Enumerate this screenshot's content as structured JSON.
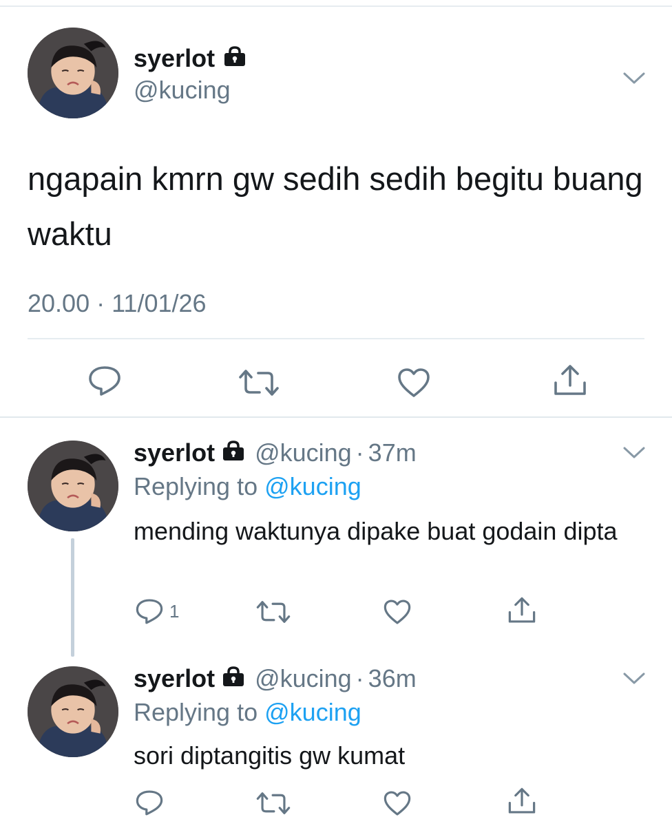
{
  "main_tweet": {
    "display_name": "syerlot",
    "handle": "@kucing",
    "text": "ngapain kmrn gw sedih sedih begitu buang waktu",
    "timestamp": "20.00 · 11/01/26",
    "icons": [
      "lock-icon",
      "chevron-down-icon",
      "reply-icon",
      "retweet-icon",
      "like-icon",
      "share-icon"
    ]
  },
  "replies": [
    {
      "display_name": "syerlot",
      "handle": "@kucing",
      "separator": "·",
      "time": "37m",
      "replying_prefix": "Replying to",
      "replying_to": "@kucing",
      "text": "mending waktunya dipake buat godain dipta",
      "reply_count": "1"
    },
    {
      "display_name": "syerlot",
      "handle": "@kucing",
      "separator": "·",
      "time": "36m",
      "replying_prefix": "Replying to",
      "replying_to": "@kucing",
      "text": "sori diptangitis gw kumat",
      "reply_count": ""
    }
  ],
  "colors": {
    "text_primary": "#14171a",
    "text_secondary": "#657786",
    "link_blue": "#1da1f2",
    "divider": "#e6ecf0",
    "thread_line": "#c4d0db"
  }
}
